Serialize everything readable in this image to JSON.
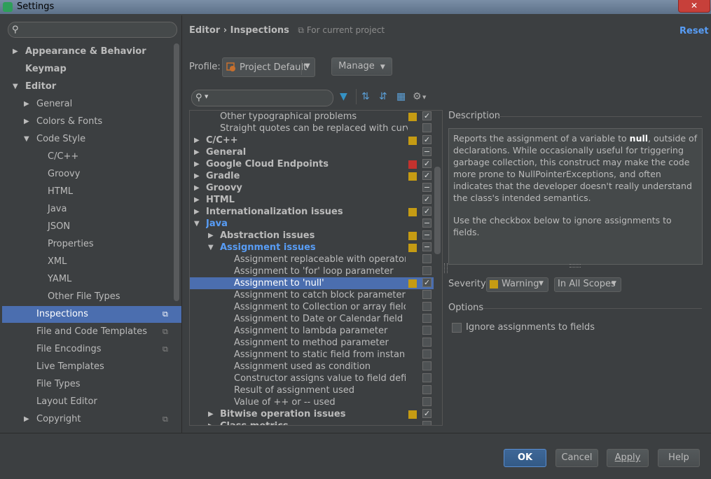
{
  "window": {
    "title": "Settings",
    "close_glyph": "✕"
  },
  "search": {
    "placeholder": ""
  },
  "sidebar": {
    "items": [
      {
        "label": "Appearance & Behavior"
      },
      {
        "label": "Keymap"
      },
      {
        "label": "Editor"
      },
      {
        "label": "General"
      },
      {
        "label": "Colors & Fonts"
      },
      {
        "label": "Code Style"
      },
      {
        "label": "C/C++"
      },
      {
        "label": "Groovy"
      },
      {
        "label": "HTML"
      },
      {
        "label": "Java"
      },
      {
        "label": "JSON"
      },
      {
        "label": "Properties"
      },
      {
        "label": "XML"
      },
      {
        "label": "YAML"
      },
      {
        "label": "Other File Types"
      },
      {
        "label": "Inspections"
      },
      {
        "label": "File and Code Templates"
      },
      {
        "label": "File Encodings"
      },
      {
        "label": "Live Templates"
      },
      {
        "label": "File Types"
      },
      {
        "label": "Layout Editor"
      },
      {
        "label": "Copyright"
      }
    ]
  },
  "header": {
    "crumb_editor": "Editor",
    "crumb_sep": "›",
    "crumb_inspections": "Inspections",
    "scope_note": "For current project",
    "reset_label": "Reset"
  },
  "profile": {
    "label": "Profile:",
    "value": "Project Default",
    "manage_label": "Manage"
  },
  "tree": {
    "rows": [
      {
        "label": "Other typographical problems"
      },
      {
        "label": "Straight quotes can be replaced with curvy quotes"
      },
      {
        "label": "C/C++"
      },
      {
        "label": "General"
      },
      {
        "label": "Google Cloud Endpoints"
      },
      {
        "label": "Gradle"
      },
      {
        "label": "Groovy"
      },
      {
        "label": "HTML"
      },
      {
        "label": "Internationalization issues"
      },
      {
        "label": "Java"
      },
      {
        "label": "Abstraction issues"
      },
      {
        "label": "Assignment issues"
      },
      {
        "label": "Assignment replaceable with operator assignment"
      },
      {
        "label": "Assignment to 'for' loop parameter"
      },
      {
        "label": "Assignment to 'null'"
      },
      {
        "label": "Assignment to catch block parameter"
      },
      {
        "label": "Assignment to Collection or array field from parameter"
      },
      {
        "label": "Assignment to Date or Calendar field from parameter"
      },
      {
        "label": "Assignment to lambda parameter"
      },
      {
        "label": "Assignment to method parameter"
      },
      {
        "label": "Assignment to static field from instance context"
      },
      {
        "label": "Assignment used as condition"
      },
      {
        "label": "Constructor assigns value to field defined in superclass"
      },
      {
        "label": "Result of assignment used"
      },
      {
        "label": "Value of ++ or -- used"
      },
      {
        "label": "Bitwise operation issues"
      },
      {
        "label": "Class metrics"
      }
    ]
  },
  "description": {
    "heading": "Description",
    "p1_before": "Reports the assignment of a variable to ",
    "p1_bold": "null",
    "p1_after": ", outside of declarations. While occasionally useful for triggering garbage collection, this construct may make the code more prone to NullPointerExceptions, and often indicates that the developer doesn't really understand the class's intended semantics.",
    "p2": "Use the checkbox below to ignore assignments to fields."
  },
  "severity": {
    "label": "Severity:",
    "value": "Warning",
    "scope_value": "In All Scopes",
    "color": "#c59b13"
  },
  "options": {
    "heading": "Options",
    "ignore_label": "Ignore assignments to fields"
  },
  "buttons": {
    "ok": "OK",
    "cancel": "Cancel",
    "apply": "Apply",
    "help": "Help"
  }
}
